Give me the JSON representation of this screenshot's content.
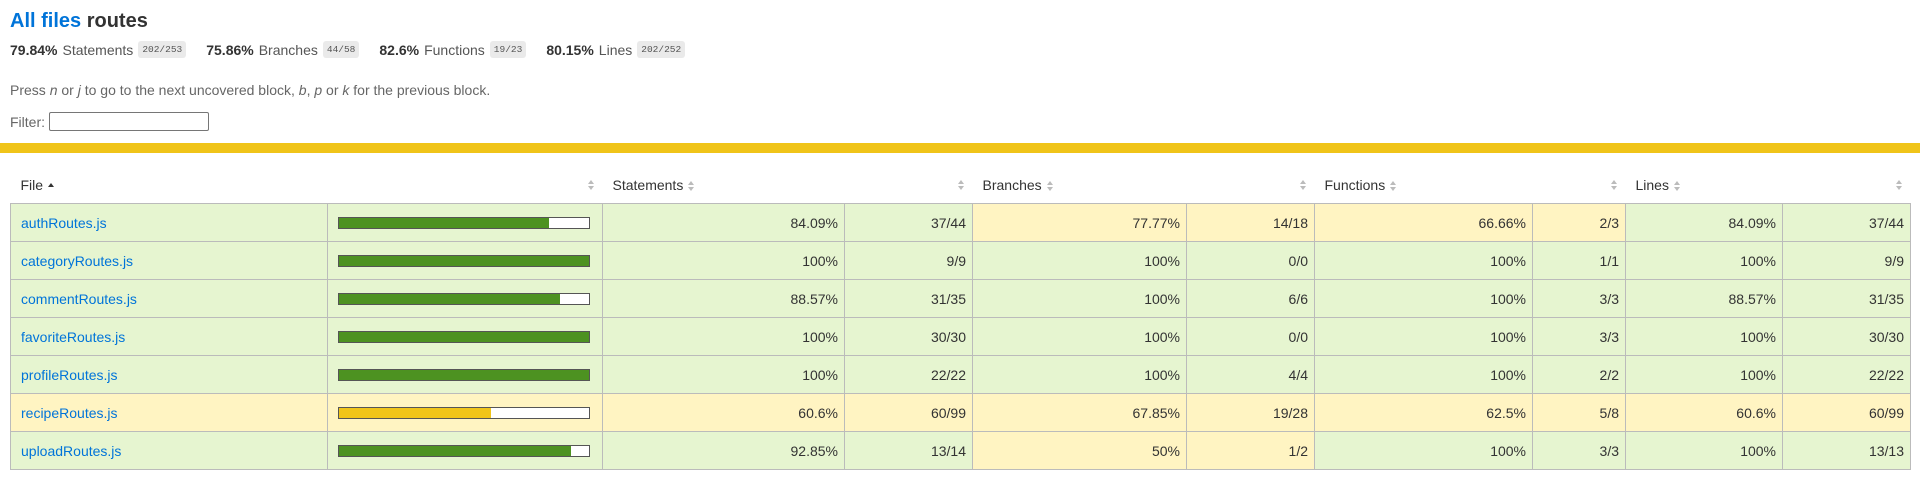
{
  "header": {
    "all_files_link": "All files",
    "current_dir": "routes"
  },
  "summary": [
    {
      "pct": "79.84%",
      "label": "Statements",
      "fraction": "202/253"
    },
    {
      "pct": "75.86%",
      "label": "Branches",
      "fraction": "44/58"
    },
    {
      "pct": "82.6%",
      "label": "Functions",
      "fraction": "19/23"
    },
    {
      "pct": "80.15%",
      "label": "Lines",
      "fraction": "202/252"
    }
  ],
  "hint": {
    "t1": "Press ",
    "k1": "n",
    "t2": " or ",
    "k2": "j",
    "t3": " to go to the next uncovered block, ",
    "k3": "b",
    "t4": ", ",
    "k4": "p",
    "t5": " or ",
    "k5": "k",
    "t6": " for the previous block."
  },
  "filter": {
    "label": "Filter:",
    "value": ""
  },
  "colors": {
    "accent_link": "#0074D9",
    "status_medium": "#F0C419",
    "high_bg": "#E6F5D0",
    "medium_bg": "#FFF4C2",
    "high_bar": "#4D9221"
  },
  "table": {
    "headers": {
      "file": "File",
      "statements": "Statements",
      "branches": "Branches",
      "functions": "Functions",
      "lines": "Lines"
    },
    "rows": [
      {
        "file": "authRoutes.js",
        "bar_pct": 84.09,
        "row_class": "high",
        "stmt_pct": "84.09%",
        "stmt_frac": "37/44",
        "stmt_class": "high",
        "br_pct": "77.77%",
        "br_frac": "14/18",
        "br_class": "medium",
        "fn_pct": "66.66%",
        "fn_frac": "2/3",
        "fn_class": "medium",
        "ln_pct": "84.09%",
        "ln_frac": "37/44",
        "ln_class": "high"
      },
      {
        "file": "categoryRoutes.js",
        "bar_pct": 100,
        "row_class": "high",
        "stmt_pct": "100%",
        "stmt_frac": "9/9",
        "stmt_class": "high",
        "br_pct": "100%",
        "br_frac": "0/0",
        "br_class": "high",
        "fn_pct": "100%",
        "fn_frac": "1/1",
        "fn_class": "high",
        "ln_pct": "100%",
        "ln_frac": "9/9",
        "ln_class": "high"
      },
      {
        "file": "commentRoutes.js",
        "bar_pct": 88.57,
        "row_class": "high",
        "stmt_pct": "88.57%",
        "stmt_frac": "31/35",
        "stmt_class": "high",
        "br_pct": "100%",
        "br_frac": "6/6",
        "br_class": "high",
        "fn_pct": "100%",
        "fn_frac": "3/3",
        "fn_class": "high",
        "ln_pct": "88.57%",
        "ln_frac": "31/35",
        "ln_class": "high"
      },
      {
        "file": "favoriteRoutes.js",
        "bar_pct": 100,
        "row_class": "high",
        "stmt_pct": "100%",
        "stmt_frac": "30/30",
        "stmt_class": "high",
        "br_pct": "100%",
        "br_frac": "0/0",
        "br_class": "high",
        "fn_pct": "100%",
        "fn_frac": "3/3",
        "fn_class": "high",
        "ln_pct": "100%",
        "ln_frac": "30/30",
        "ln_class": "high"
      },
      {
        "file": "profileRoutes.js",
        "bar_pct": 100,
        "row_class": "high",
        "stmt_pct": "100%",
        "stmt_frac": "22/22",
        "stmt_class": "high",
        "br_pct": "100%",
        "br_frac": "4/4",
        "br_class": "high",
        "fn_pct": "100%",
        "fn_frac": "2/2",
        "fn_class": "high",
        "ln_pct": "100%",
        "ln_frac": "22/22",
        "ln_class": "high"
      },
      {
        "file": "recipeRoutes.js",
        "bar_pct": 60.6,
        "row_class": "medium",
        "stmt_pct": "60.6%",
        "stmt_frac": "60/99",
        "stmt_class": "medium",
        "br_pct": "67.85%",
        "br_frac": "19/28",
        "br_class": "medium",
        "fn_pct": "62.5%",
        "fn_frac": "5/8",
        "fn_class": "medium",
        "ln_pct": "60.6%",
        "ln_frac": "60/99",
        "ln_class": "medium"
      },
      {
        "file": "uploadRoutes.js",
        "bar_pct": 92.85,
        "row_class": "high",
        "stmt_pct": "92.85%",
        "stmt_frac": "13/14",
        "stmt_class": "high",
        "br_pct": "50%",
        "br_frac": "1/2",
        "br_class": "medium",
        "fn_pct": "100%",
        "fn_frac": "3/3",
        "fn_class": "high",
        "ln_pct": "100%",
        "ln_frac": "13/13",
        "ln_class": "high"
      }
    ]
  }
}
